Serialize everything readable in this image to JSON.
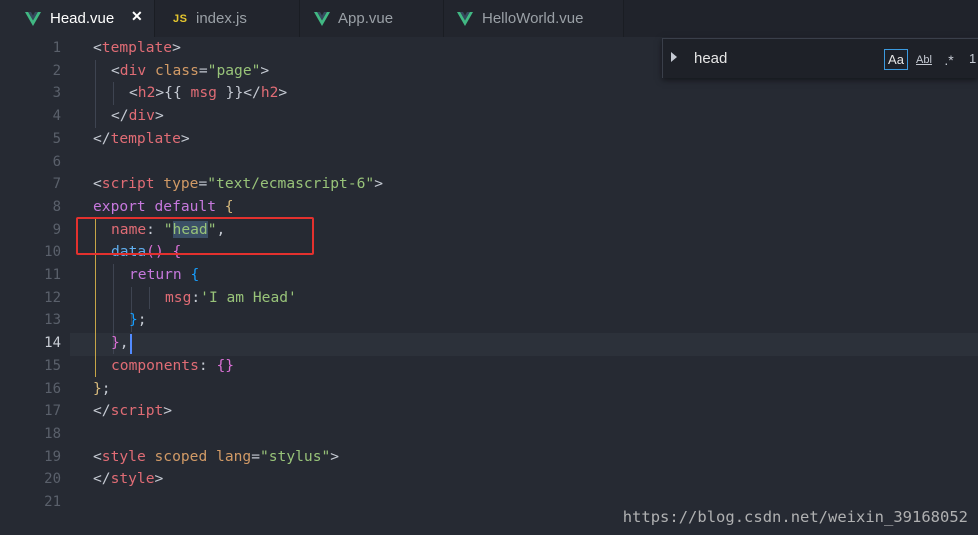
{
  "tabs": [
    {
      "label": "Head.vue",
      "icon": "vue-icon",
      "active": true
    },
    {
      "label": "index.js",
      "icon": "js-icon",
      "icon_text": "JS",
      "active": false
    },
    {
      "label": "App.vue",
      "icon": "vue-icon",
      "active": false
    },
    {
      "label": "HelloWorld.vue",
      "icon": "vue-icon",
      "active": false
    }
  ],
  "tab_close_glyph": "✕",
  "line_numbers": [
    "1",
    "2",
    "3",
    "4",
    "5",
    "6",
    "7",
    "8",
    "9",
    "10",
    "11",
    "12",
    "13",
    "14",
    "15",
    "16",
    "17",
    "18",
    "19",
    "20",
    "21"
  ],
  "current_line": 14,
  "code": {
    "l1": {
      "open": "<",
      "tag": "template",
      "close": ">"
    },
    "l2": {
      "open": "<",
      "tag": "div",
      "attr": " class",
      "eq": "=",
      "val": "\"page\"",
      "close": ">"
    },
    "l3": {
      "open": "<",
      "tag": "h2",
      "close": ">",
      "mustache_open": "{{ ",
      "var": "msg",
      "mustache_close": " }}",
      "end_open": "</",
      "end_tag": "h2",
      "end_close": ">"
    },
    "l4": {
      "open": "</",
      "tag": "div",
      "close": ">"
    },
    "l5": {
      "open": "</",
      "tag": "template",
      "close": ">"
    },
    "l7": {
      "open": "<",
      "tag": "script",
      "attr": " type",
      "eq": "=",
      "val": "\"text/ecmascript-6\"",
      "close": ">"
    },
    "l8": {
      "kw1": "export",
      "kw2": " default",
      "brace": " {"
    },
    "l9": {
      "prop": "name",
      "colon": ": ",
      "q1": "\"",
      "word": "head",
      "q2": "\"",
      "comma": ","
    },
    "l10": {
      "fn": "data",
      "parens": "()",
      "brace": " {"
    },
    "l11": {
      "kw": "return",
      "brace": " {"
    },
    "l12": {
      "prop": "msg",
      "colon": ":",
      "val": "'I am Head'"
    },
    "l13": {
      "brace": "}",
      "semi": ";"
    },
    "l14": {
      "brace": "}",
      "comma": ","
    },
    "l15": {
      "prop": "components",
      "colon": ": ",
      "braces": "{}"
    },
    "l16": {
      "brace": "}",
      "semi": ";"
    },
    "l17": {
      "open": "</",
      "tag": "script",
      "close": ">"
    },
    "l19": {
      "open": "<",
      "tag": "style",
      "attr1": " scoped",
      "attr2": " lang",
      "eq": "=",
      "val": "\"stylus\"",
      "close": ">"
    },
    "l20": {
      "open": "</",
      "tag": "style",
      "close": ">"
    }
  },
  "find": {
    "value": "head",
    "case_label": "Aa",
    "word_label": "Abl",
    "regex_label": ".*",
    "count": "1"
  },
  "watermark": "https://blog.csdn.net/weixin_39168052",
  "colors": {
    "background": "#262a33",
    "annotation_box": "#e3312e",
    "vue_green": "#41b883",
    "js_yellow": "#e6c72e"
  }
}
